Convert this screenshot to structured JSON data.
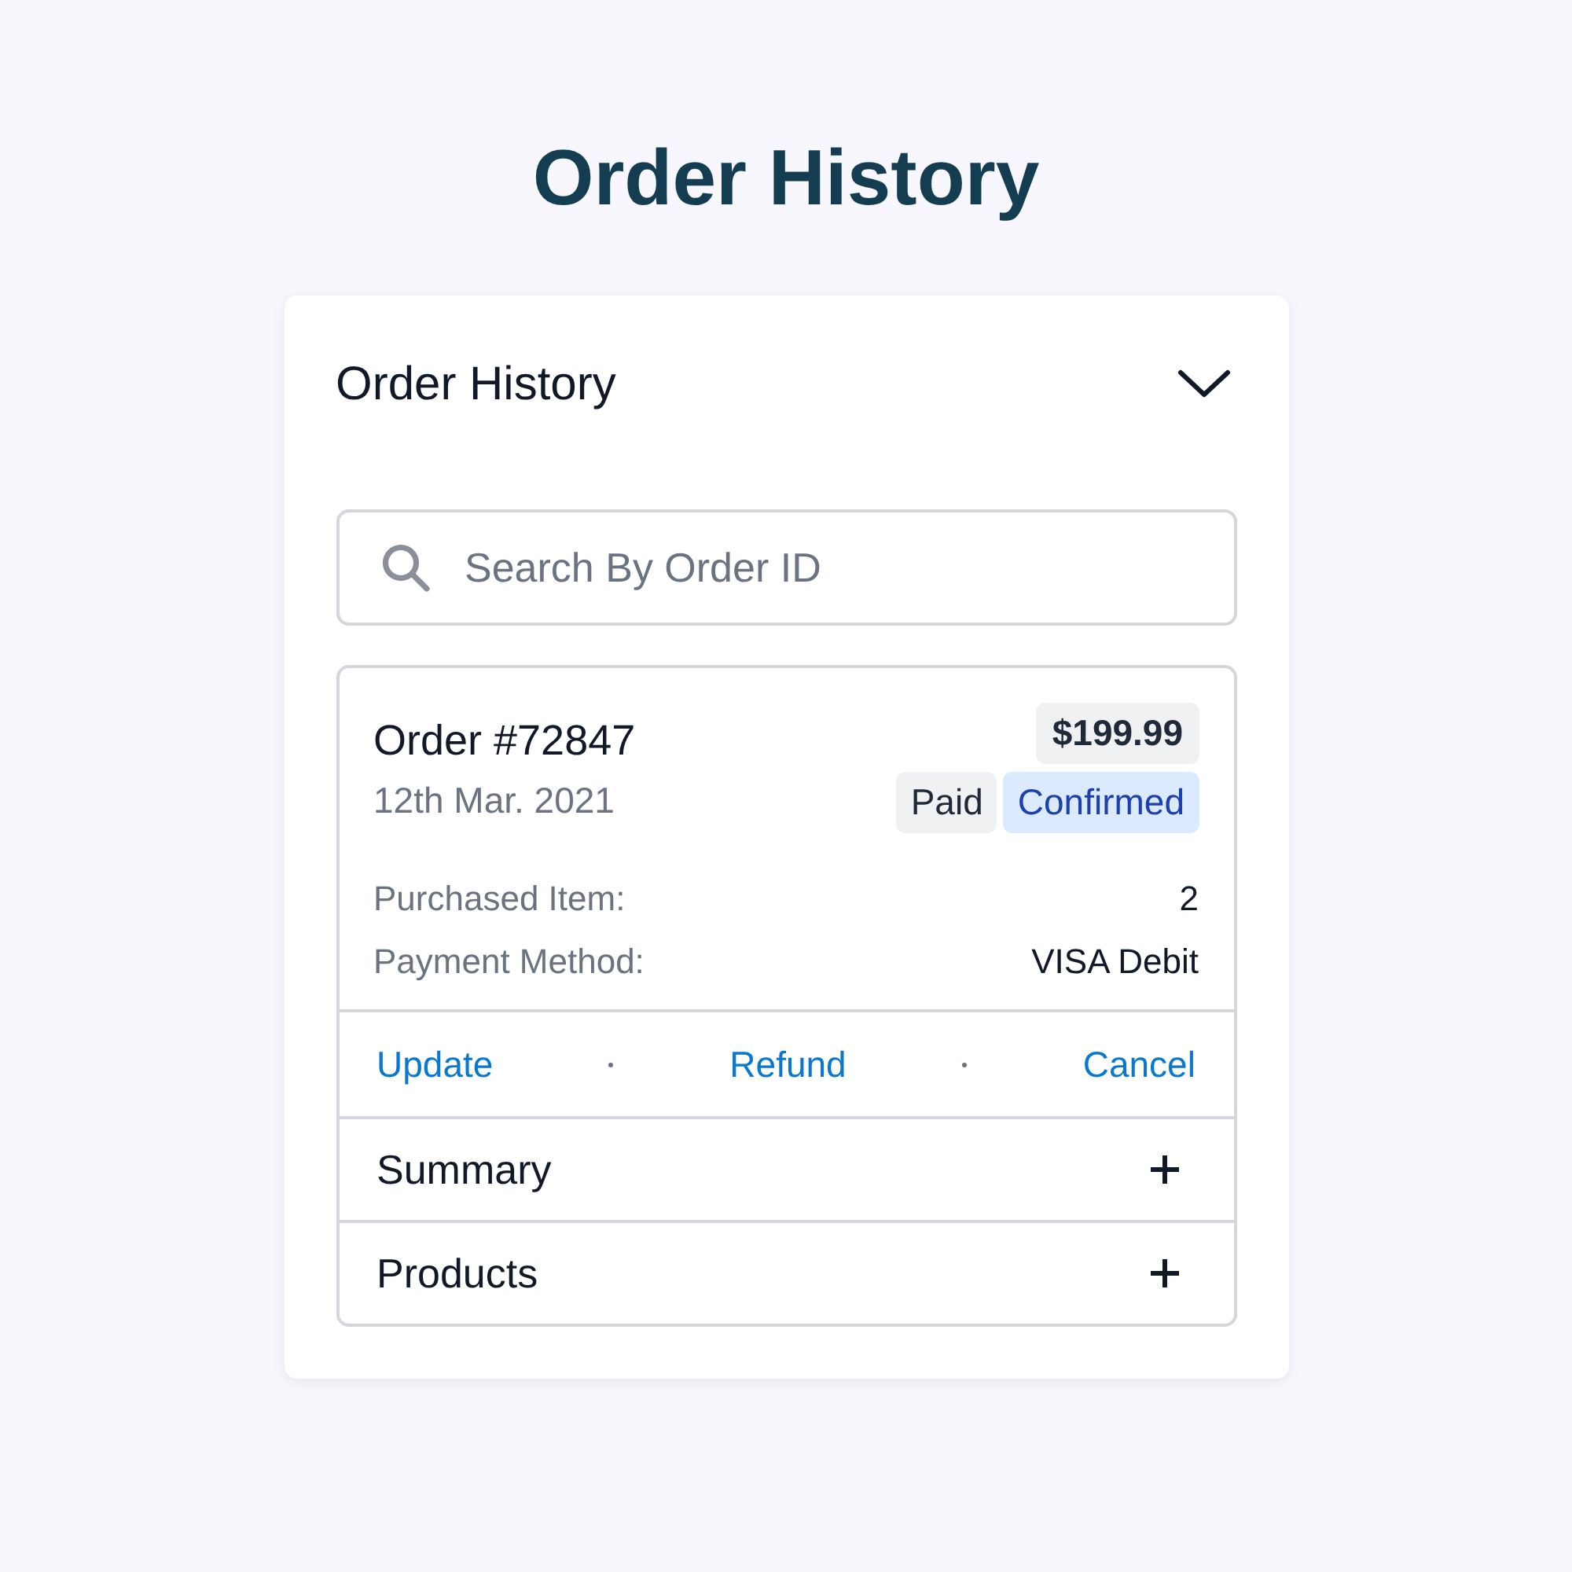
{
  "page_title": "Order History",
  "panel": {
    "title": "Order History",
    "expanded": true
  },
  "search": {
    "placeholder": "Search By Order ID"
  },
  "order": {
    "number": "Order #72847",
    "date": "12th Mar. 2021",
    "total": "$199.99",
    "badges": [
      {
        "label": "Paid",
        "kind": "neutral"
      },
      {
        "label": "Confirmed",
        "kind": "info"
      }
    ],
    "details": [
      {
        "label": "Purchased Item:",
        "value": "2"
      },
      {
        "label": "Payment Method:",
        "value": "VISA Debit"
      }
    ],
    "actions": [
      "Update",
      "Refund",
      "Cancel"
    ],
    "sections": [
      {
        "label": "Summary",
        "expanded": false
      },
      {
        "label": "Products",
        "expanded": false
      }
    ]
  }
}
